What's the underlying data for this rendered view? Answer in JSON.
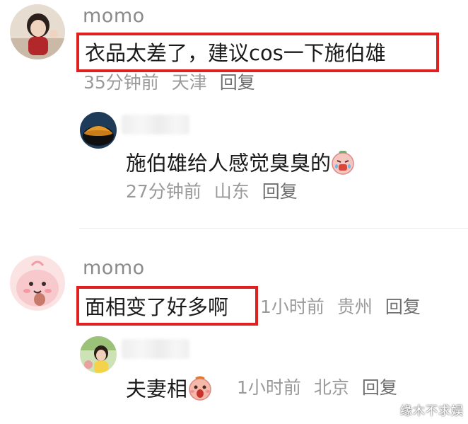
{
  "comments": [
    {
      "username": "momo",
      "text": "衣品太差了，建议cos一下施伯雄",
      "time": "35分钟前",
      "location": "天津",
      "reply_label": "回复",
      "reply": {
        "text": "施伯雄给人感觉臭臭的",
        "time": "27分钟前",
        "location": "山东",
        "reply_label": "回复"
      }
    },
    {
      "username": "momo",
      "text": "面相变了好多啊",
      "time": "1小时前",
      "location": "贵州",
      "reply_label": "回复",
      "reply": {
        "text": "夫妻相",
        "time": "1小时前",
        "location": "北京",
        "reply_label": "回复"
      }
    }
  ],
  "watermark": "缘木不求娱",
  "colors": {
    "highlight_box": "#e0201e",
    "meta_text": "#9a9a9a",
    "username": "#8a8a8a"
  },
  "icons": [
    "emoji-crying-face-icon",
    "emoji-surprised-face-icon"
  ]
}
